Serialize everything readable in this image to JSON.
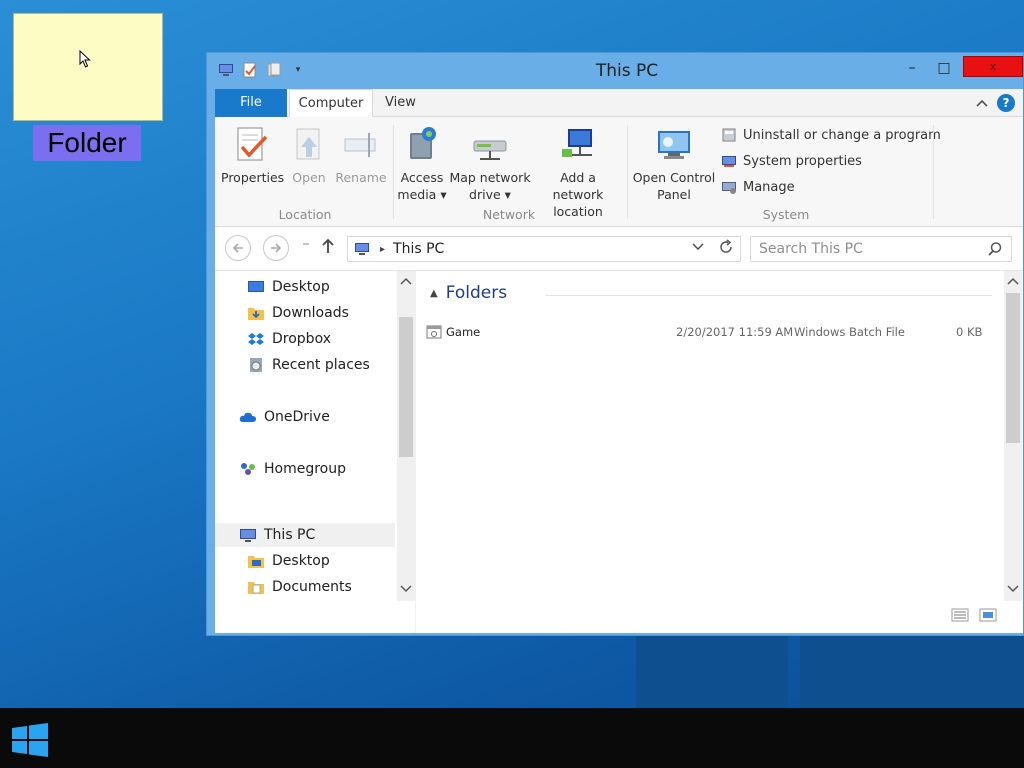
{
  "desktop": {
    "folder_label": "Folder"
  },
  "window": {
    "title": "This PC",
    "controls": {
      "minimize": "–",
      "maximize": "□",
      "close": "x"
    }
  },
  "ribbon": {
    "tabs": [
      {
        "label": "File"
      },
      {
        "label": "Computer"
      },
      {
        "label": "View"
      }
    ],
    "help": "?",
    "location": {
      "group_label": "Location",
      "properties": "Properties",
      "open": "Open",
      "rename": "Rename"
    },
    "network": {
      "group_label": "Network",
      "access_media": [
        "Access",
        "media ▾"
      ],
      "map_network_drive": [
        "Map network",
        "drive ▾"
      ],
      "add_network_location": [
        "Add a network",
        "location"
      ]
    },
    "system": {
      "group_label": "System",
      "open_control_panel": [
        "Open Control",
        "Panel"
      ],
      "uninstall": "Uninstall or change a program",
      "system_properties": "System properties",
      "manage": "Manage"
    }
  },
  "address_bar": {
    "path": "This PC",
    "search_placeholder": "Search This PC"
  },
  "nav_pane": {
    "items": [
      {
        "label": "Desktop"
      },
      {
        "label": "Downloads"
      },
      {
        "label": "Dropbox"
      },
      {
        "label": "Recent places"
      },
      {
        "label": "OneDrive"
      },
      {
        "label": "Homegroup"
      },
      {
        "label": "This PC"
      },
      {
        "label": "Desktop"
      },
      {
        "label": "Documents"
      }
    ]
  },
  "content": {
    "section_title": "Folders",
    "files": [
      {
        "name": "Game",
        "date": "2/20/2017 11:59 AM",
        "type": "Windows Batch File",
        "size": "0 KB"
      }
    ]
  },
  "colors": {
    "accent": "#1979ca",
    "close_button": "#e81010",
    "taskbar": "#0a0a0a",
    "folder_bg": "#fdfcc4",
    "folder_label_bg": "#7b6ff0"
  }
}
